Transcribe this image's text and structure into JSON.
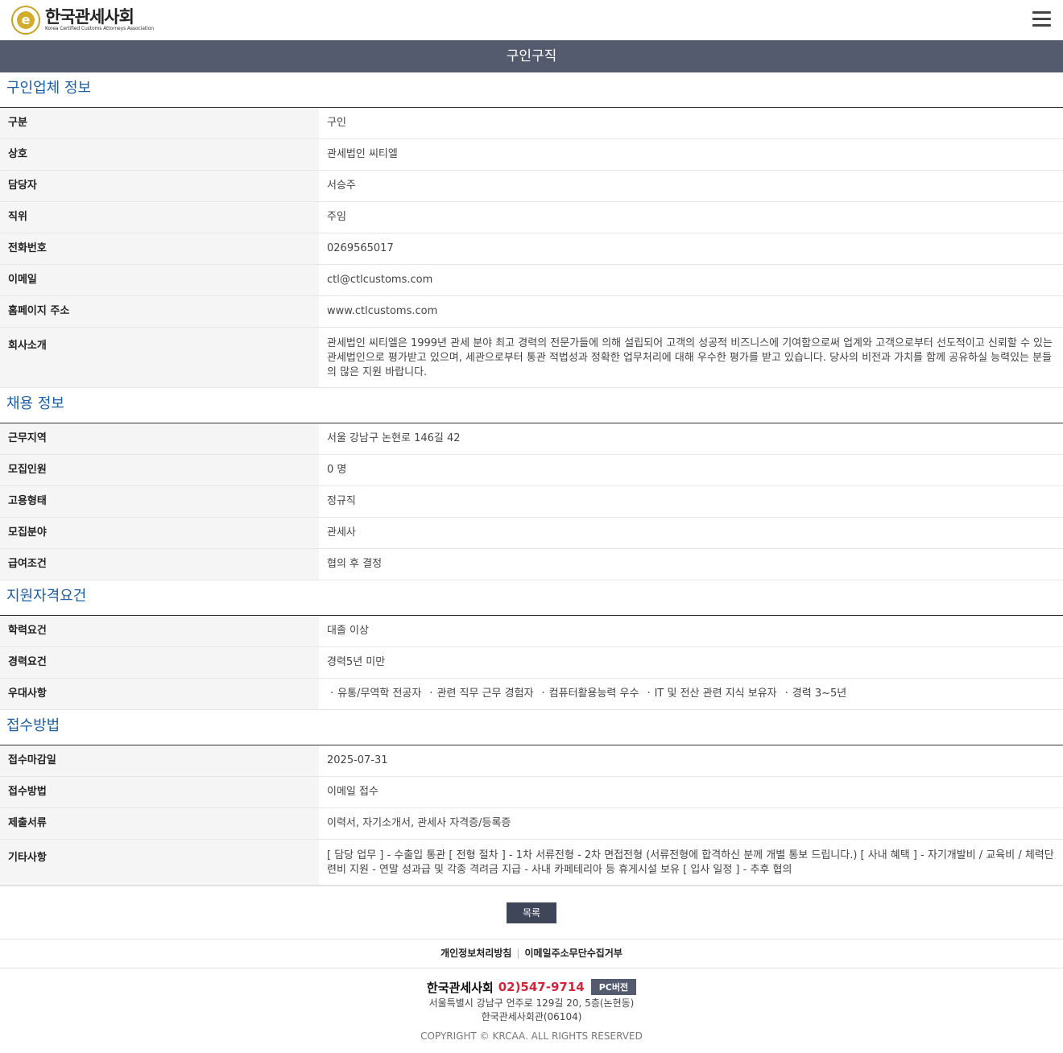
{
  "header": {
    "logo_kor": "한국관세사회",
    "logo_eng": "Korea Certified Customs Attorneys Association",
    "page_title": "구인구직"
  },
  "company": {
    "title": "구인업체 정보",
    "rows": [
      {
        "label": "구분",
        "value": "구인"
      },
      {
        "label": "상호",
        "value": "관세법인 씨티엘"
      },
      {
        "label": "담당자",
        "value": "서승주"
      },
      {
        "label": "직위",
        "value": "주임"
      },
      {
        "label": "전화번호",
        "value": "0269565017"
      },
      {
        "label": "이메일",
        "value": "ctl@ctlcustoms.com"
      },
      {
        "label": "홈페이지 주소",
        "value": "www.ctlcustoms.com"
      },
      {
        "label": "회사소개",
        "value": "관세법인 씨티엘은 1999년 관세 분야 최고 경력의 전문가들에 의해 설립되어 고객의 성공적 비즈니스에 기여함으로써 업계와 고객으로부터 선도적이고 신뢰할 수 있는 관세법인으로 평가받고 있으며, 세관으로부터 통관 적법성과 정확한 업무처리에 대해 우수한 평가를 받고 있습니다. 당사의 비전과 가치를 함께 공유하실 능력있는 분들의 많은 지원 바랍니다."
      }
    ]
  },
  "recruit": {
    "title": "채용 정보",
    "rows": [
      {
        "label": "근무지역",
        "value": "서울 강남구 논현로 146길 42"
      },
      {
        "label": "모집인원",
        "value": "0 명"
      },
      {
        "label": "고용형태",
        "value": "정규직"
      },
      {
        "label": "모집분야",
        "value": "관세사"
      },
      {
        "label": "급여조건",
        "value": "협의 후 결정"
      }
    ]
  },
  "qualify": {
    "title": "지원자격요건",
    "rows": [
      {
        "label": "학력요건",
        "value": "대졸 이상"
      },
      {
        "label": "경력요건",
        "value": "경력5년 미만"
      }
    ],
    "pref_label": "우대사항",
    "preferences": [
      "유통/무역학 전공자",
      "관련 직무 근무 경험자",
      "컴퓨터활용능력 우수",
      "IT 및 전산 관련 지식 보유자",
      "경력 3~5년"
    ]
  },
  "apply": {
    "title": "접수방법",
    "rows": [
      {
        "label": "접수마감일",
        "value": "2025-07-31"
      },
      {
        "label": "접수방법",
        "value": "이메일 접수"
      },
      {
        "label": "제출서류",
        "value": "이력서, 자기소개서, 관세사 자격증/등록증"
      },
      {
        "label": "기타사항",
        "value": "[ 담당 업무 ] - 수출입 통관 [ 전형 절차 ] - 1차 서류전형 - 2차 면접전형 (서류전형에 합격하신 분께 개별 통보 드립니다.) [ 사내 혜택 ] - 자기개발비 / 교육비 / 체력단련비 지원 - 연말 성과급 및 각종 격려금 지급 - 사내 카페테리아 등 휴게시설 보유 [ 입사 일정 ] - 추후 협의"
      }
    ]
  },
  "buttons": {
    "list": "목록"
  },
  "footer": {
    "privacy": "개인정보처리방침",
    "email_refuse": "이메일주소무단수집거부",
    "org": "한국관세사회",
    "tel": "02)547-9714",
    "pc": "PC버전",
    "addr1": "서울특별시 강남구 언주로 129길 20, 5층(논현동)",
    "addr2": "한국관세사회관(06104)",
    "copyright": "COPYRIGHT © KRCAA. ALL RIGHTS RESERVED"
  }
}
